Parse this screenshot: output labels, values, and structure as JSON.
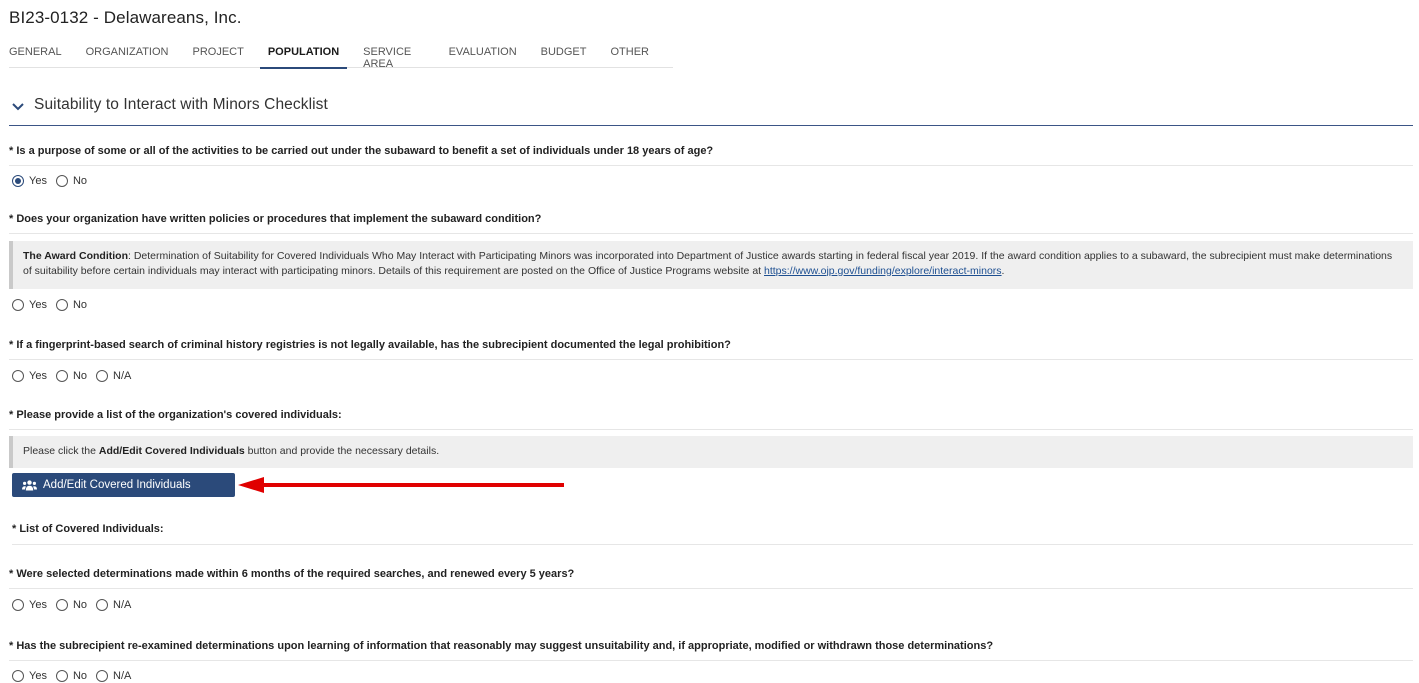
{
  "page": {
    "title": "BI23-0132 - Delawareans, Inc."
  },
  "tabs": [
    {
      "label": "GENERAL"
    },
    {
      "label": "ORGANIZATION"
    },
    {
      "label": "PROJECT"
    },
    {
      "label": "POPULATION"
    },
    {
      "label": "SERVICE AREA"
    },
    {
      "label": "EVALUATION"
    },
    {
      "label": "BUDGET"
    },
    {
      "label": "OTHER"
    }
  ],
  "active_tab": "POPULATION",
  "section": {
    "title": "Suitability to Interact with Minors Checklist",
    "icon": "chevron-down-icon"
  },
  "q1": {
    "text": "* Is a purpose of some or all of the activities to be carried out under the subaward to benefit a set of individuals under 18 years of age?",
    "options": [
      "Yes",
      "No"
    ],
    "selected": "Yes"
  },
  "q2": {
    "text": "* Does your organization have written policies or procedures that implement the subaward condition?",
    "options": [
      "Yes",
      "No"
    ],
    "selected": ""
  },
  "award_note": {
    "bold": "The Award Condition",
    "text": ": Determination of Suitability for Covered Individuals Who May Interact with Participating Minors was incorporated into Department of Justice awards starting in federal fiscal year 2019. If the award condition applies to a subaward, the subrecipient must make determinations of suitability before certain individuals may interact with participating minors. Details of this requirement are posted on the Office of Justice Programs website at ",
    "link": "https://www.ojp.gov/funding/explore/interact-minors",
    "end": "."
  },
  "q3": {
    "text": "* If a fingerprint-based search of criminal history registries is not legally available, has the subrecipient documented the legal prohibition?",
    "options": [
      "Yes",
      "No",
      "N/A"
    ],
    "selected": ""
  },
  "q4": {
    "text": "* Please provide a list of the organization's covered individuals:"
  },
  "covered_note": {
    "prefix": "Please click the ",
    "bold": "Add/Edit Covered Individuals",
    "suffix": " button and provide the necessary details."
  },
  "add_button": {
    "label": "Add/Edit Covered Individuals",
    "icon": "users-icon",
    "color": "#2b4a7a"
  },
  "annotation_arrow": {
    "color": "#e00000"
  },
  "list_label": {
    "text": "* List of Covered Individuals:"
  },
  "q5": {
    "text": "* Were selected determinations made within 6 months of the required searches, and renewed every 5 years?",
    "options": [
      "Yes",
      "No",
      "N/A"
    ],
    "selected": ""
  },
  "q6": {
    "text": "* Has the subrecipient re-examined determinations upon learning of information that reasonably may suggest unsuitability and, if appropriate, modified or withdrawn those determinations?",
    "options": [
      "Yes",
      "No",
      "N/A"
    ],
    "selected": ""
  }
}
